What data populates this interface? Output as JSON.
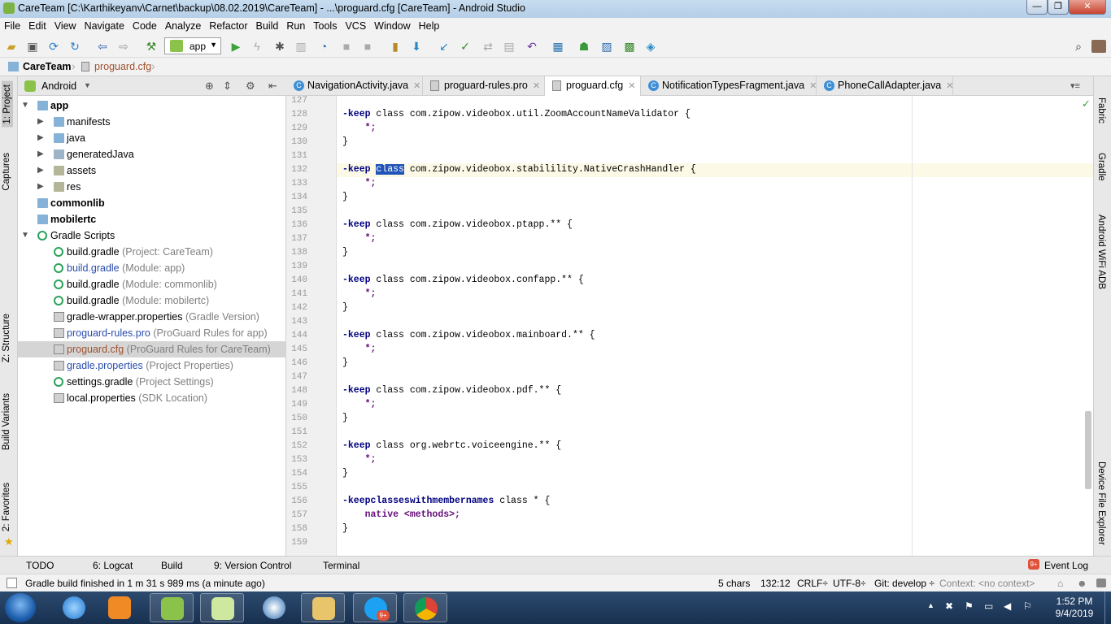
{
  "window": {
    "title": "CareTeam [C:\\Karthikeyanv\\Carnet\\backup\\08.02.2019\\CareTeam] - ...\\proguard.cfg [CareTeam] - Android Studio",
    "minimize": "—",
    "maximize": "❐",
    "close": "✕"
  },
  "menu": [
    "File",
    "Edit",
    "View",
    "Navigate",
    "Code",
    "Analyze",
    "Refactor",
    "Build",
    "Run",
    "Tools",
    "VCS",
    "Window",
    "Help"
  ],
  "toolbar": {
    "run_config": "app"
  },
  "breadcrumb": {
    "project": "CareTeam",
    "file": "proguard.cfg"
  },
  "project_panel": {
    "view_mode": "Android",
    "tree": [
      {
        "name": "app",
        "hint": ""
      },
      {
        "name": "manifests",
        "hint": ""
      },
      {
        "name": "java",
        "hint": ""
      },
      {
        "name": "generatedJava",
        "hint": ""
      },
      {
        "name": "assets",
        "hint": ""
      },
      {
        "name": "res",
        "hint": ""
      },
      {
        "name": "commonlib",
        "hint": ""
      },
      {
        "name": "mobilertc",
        "hint": ""
      },
      {
        "name": "Gradle Scripts",
        "hint": ""
      },
      {
        "name": "build.gradle",
        "hint": "(Project: CareTeam)"
      },
      {
        "name": "build.gradle",
        "hint": "(Module: app)"
      },
      {
        "name": "build.gradle",
        "hint": "(Module: commonlib)"
      },
      {
        "name": "build.gradle",
        "hint": "(Module: mobilertc)"
      },
      {
        "name": "gradle-wrapper.properties",
        "hint": "(Gradle Version)"
      },
      {
        "name": "proguard-rules.pro",
        "hint": "(ProGuard Rules for app)"
      },
      {
        "name": "proguard.cfg",
        "hint": "(ProGuard Rules for CareTeam)"
      },
      {
        "name": "gradle.properties",
        "hint": "(Project Properties)"
      },
      {
        "name": "settings.gradle",
        "hint": "(Project Settings)"
      },
      {
        "name": "local.properties",
        "hint": "(SDK Location)"
      }
    ]
  },
  "left_tool_tabs": [
    "1: Project",
    "Captures",
    "Z: Structure",
    "Build Variants",
    "2: Favorites"
  ],
  "right_tool_tabs": [
    "Fabric",
    "Gradle",
    "Android WiFi ADB",
    "Device File Explorer"
  ],
  "editor_tabs": [
    "NavigationActivity.java",
    "proguard-rules.pro",
    "proguard.cfg",
    "NotificationTypesFragment.java",
    "PhoneCallAdapter.java"
  ],
  "editor_tab_icon_letter": "C",
  "editor": {
    "first_line": 127,
    "lines": [
      {
        "n": "127",
        "k": "",
        "s": "",
        "t": ""
      },
      {
        "n": "128",
        "k": "-keep",
        "s": "",
        "t": " class com.zipow.videobox.util.ZoomAccountNameValidator {"
      },
      {
        "n": "129",
        "k": "",
        "s": "*;",
        "t": ""
      },
      {
        "n": "130",
        "k": "",
        "s": "",
        "t": "}"
      },
      {
        "n": "131",
        "k": "",
        "s": "",
        "t": ""
      },
      {
        "n": "132",
        "k": "-keep",
        "s": "",
        "t": " com.zipow.videobox.stabilility.NativeCrashHandler {",
        "sel": "class"
      },
      {
        "n": "133",
        "k": "",
        "s": "*;",
        "t": ""
      },
      {
        "n": "134",
        "k": "",
        "s": "",
        "t": "}"
      },
      {
        "n": "135",
        "k": "",
        "s": "",
        "t": ""
      },
      {
        "n": "136",
        "k": "-keep",
        "s": "",
        "t": " class com.zipow.videobox.ptapp.** {"
      },
      {
        "n": "137",
        "k": "",
        "s": "*;",
        "t": ""
      },
      {
        "n": "138",
        "k": "",
        "s": "",
        "t": "}"
      },
      {
        "n": "139",
        "k": "",
        "s": "",
        "t": ""
      },
      {
        "n": "140",
        "k": "-keep",
        "s": "",
        "t": " class com.zipow.videobox.confapp.** {"
      },
      {
        "n": "141",
        "k": "",
        "s": "*;",
        "t": ""
      },
      {
        "n": "142",
        "k": "",
        "s": "",
        "t": "}"
      },
      {
        "n": "143",
        "k": "",
        "s": "",
        "t": ""
      },
      {
        "n": "144",
        "k": "-keep",
        "s": "",
        "t": " class com.zipow.videobox.mainboard.** {"
      },
      {
        "n": "145",
        "k": "",
        "s": "*;",
        "t": ""
      },
      {
        "n": "146",
        "k": "",
        "s": "",
        "t": "}"
      },
      {
        "n": "147",
        "k": "",
        "s": "",
        "t": ""
      },
      {
        "n": "148",
        "k": "-keep",
        "s": "",
        "t": " class com.zipow.videobox.pdf.** {"
      },
      {
        "n": "149",
        "k": "",
        "s": "*;",
        "t": ""
      },
      {
        "n": "150",
        "k": "",
        "s": "",
        "t": "}"
      },
      {
        "n": "151",
        "k": "",
        "s": "",
        "t": ""
      },
      {
        "n": "152",
        "k": "-keep",
        "s": "",
        "t": " class org.webrtc.voiceengine.** {"
      },
      {
        "n": "153",
        "k": "",
        "s": "*;",
        "t": ""
      },
      {
        "n": "154",
        "k": "",
        "s": "",
        "t": "}"
      },
      {
        "n": "155",
        "k": "",
        "s": "",
        "t": ""
      },
      {
        "n": "156",
        "k": "-keepclasseswithmembernames",
        "s": "",
        "t": " class * {"
      },
      {
        "n": "157",
        "k": "",
        "s": "native <methods>;",
        "t": ""
      },
      {
        "n": "158",
        "k": "",
        "s": "",
        "t": "}"
      },
      {
        "n": "159",
        "k": "",
        "s": "",
        "t": ""
      }
    ]
  },
  "bottom_tabs": [
    "TODO",
    "6: Logcat",
    "Build",
    "9: Version Control",
    "Terminal",
    "Event Log"
  ],
  "event_log_badge": "9+",
  "status": {
    "message": "Gradle build finished in 1 m 31 s 989 ms (a minute ago)",
    "chars": "5 chars",
    "position": "132:12",
    "line_sep": "CRLF÷",
    "encoding": "UTF-8÷",
    "git": "Git: develop ÷",
    "context": "Context: <no context>"
  },
  "taskbar": {
    "skype_badge": "9+",
    "time": "1:52 PM",
    "date": "9/4/2019"
  },
  "colors": {
    "keyword": "#000080",
    "string": "#660e7a",
    "selection": "#2154b8",
    "current_line": "#fcfae6",
    "gradle_green": "#2aa35a"
  }
}
